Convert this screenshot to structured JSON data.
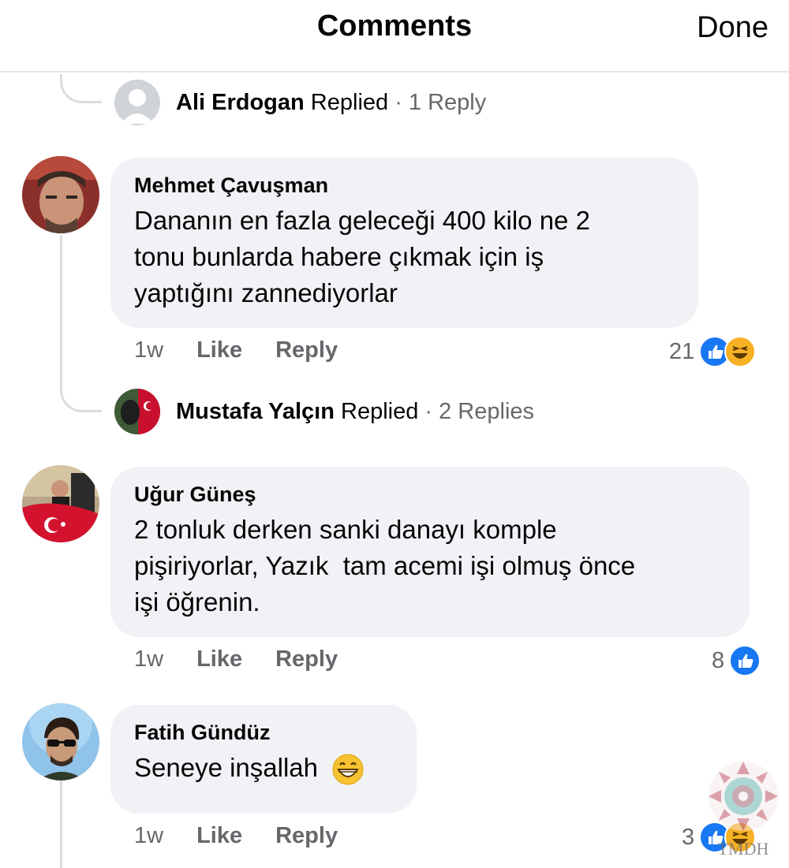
{
  "header": {
    "title": "Comments",
    "done_label": "Done"
  },
  "thread_replies": [
    {
      "name": "Ali Erdogan",
      "verb": "Replied",
      "count": "· 1 Reply"
    },
    {
      "name": "Mustafa Yalçın",
      "verb": "Replied",
      "count": "· 2 Replies"
    }
  ],
  "comments": [
    {
      "author": "Mehmet Çavuşman",
      "lines": [
        "Dananın en fazla geleceği 400 kilo ne 2",
        "tonu bunlarda habere çıkmak için iş",
        "yaptığını zannediyorlar"
      ],
      "time": "1w",
      "like_label": "Like",
      "reply_label": "Reply",
      "reactions": {
        "count": "21",
        "types": [
          "like",
          "haha"
        ]
      }
    },
    {
      "author": "Uğur Güneş",
      "lines": [
        "2 tonluk derken sanki danayı komple",
        "pişiriyorlar, Yazık  tam acemi işi olmuş önce",
        "işi öğrenin."
      ],
      "time": "1w",
      "like_label": "Like",
      "reply_label": "Reply",
      "reactions": {
        "count": "8",
        "types": [
          "like"
        ]
      }
    },
    {
      "author": "Fatih Gündüz",
      "lines": [
        "Seneye inşallah"
      ],
      "emoji": "grinning-face",
      "time": "1w",
      "like_label": "Like",
      "reply_label": "Reply",
      "reactions": {
        "count": "3",
        "types": [
          "like",
          "haha"
        ]
      }
    }
  ],
  "watermark": {
    "text": "TMDH"
  },
  "colors": {
    "like": "#1877f2",
    "haha": "#f7b125",
    "bubble": "#f0f2f5",
    "secondary_text": "#65676b"
  }
}
